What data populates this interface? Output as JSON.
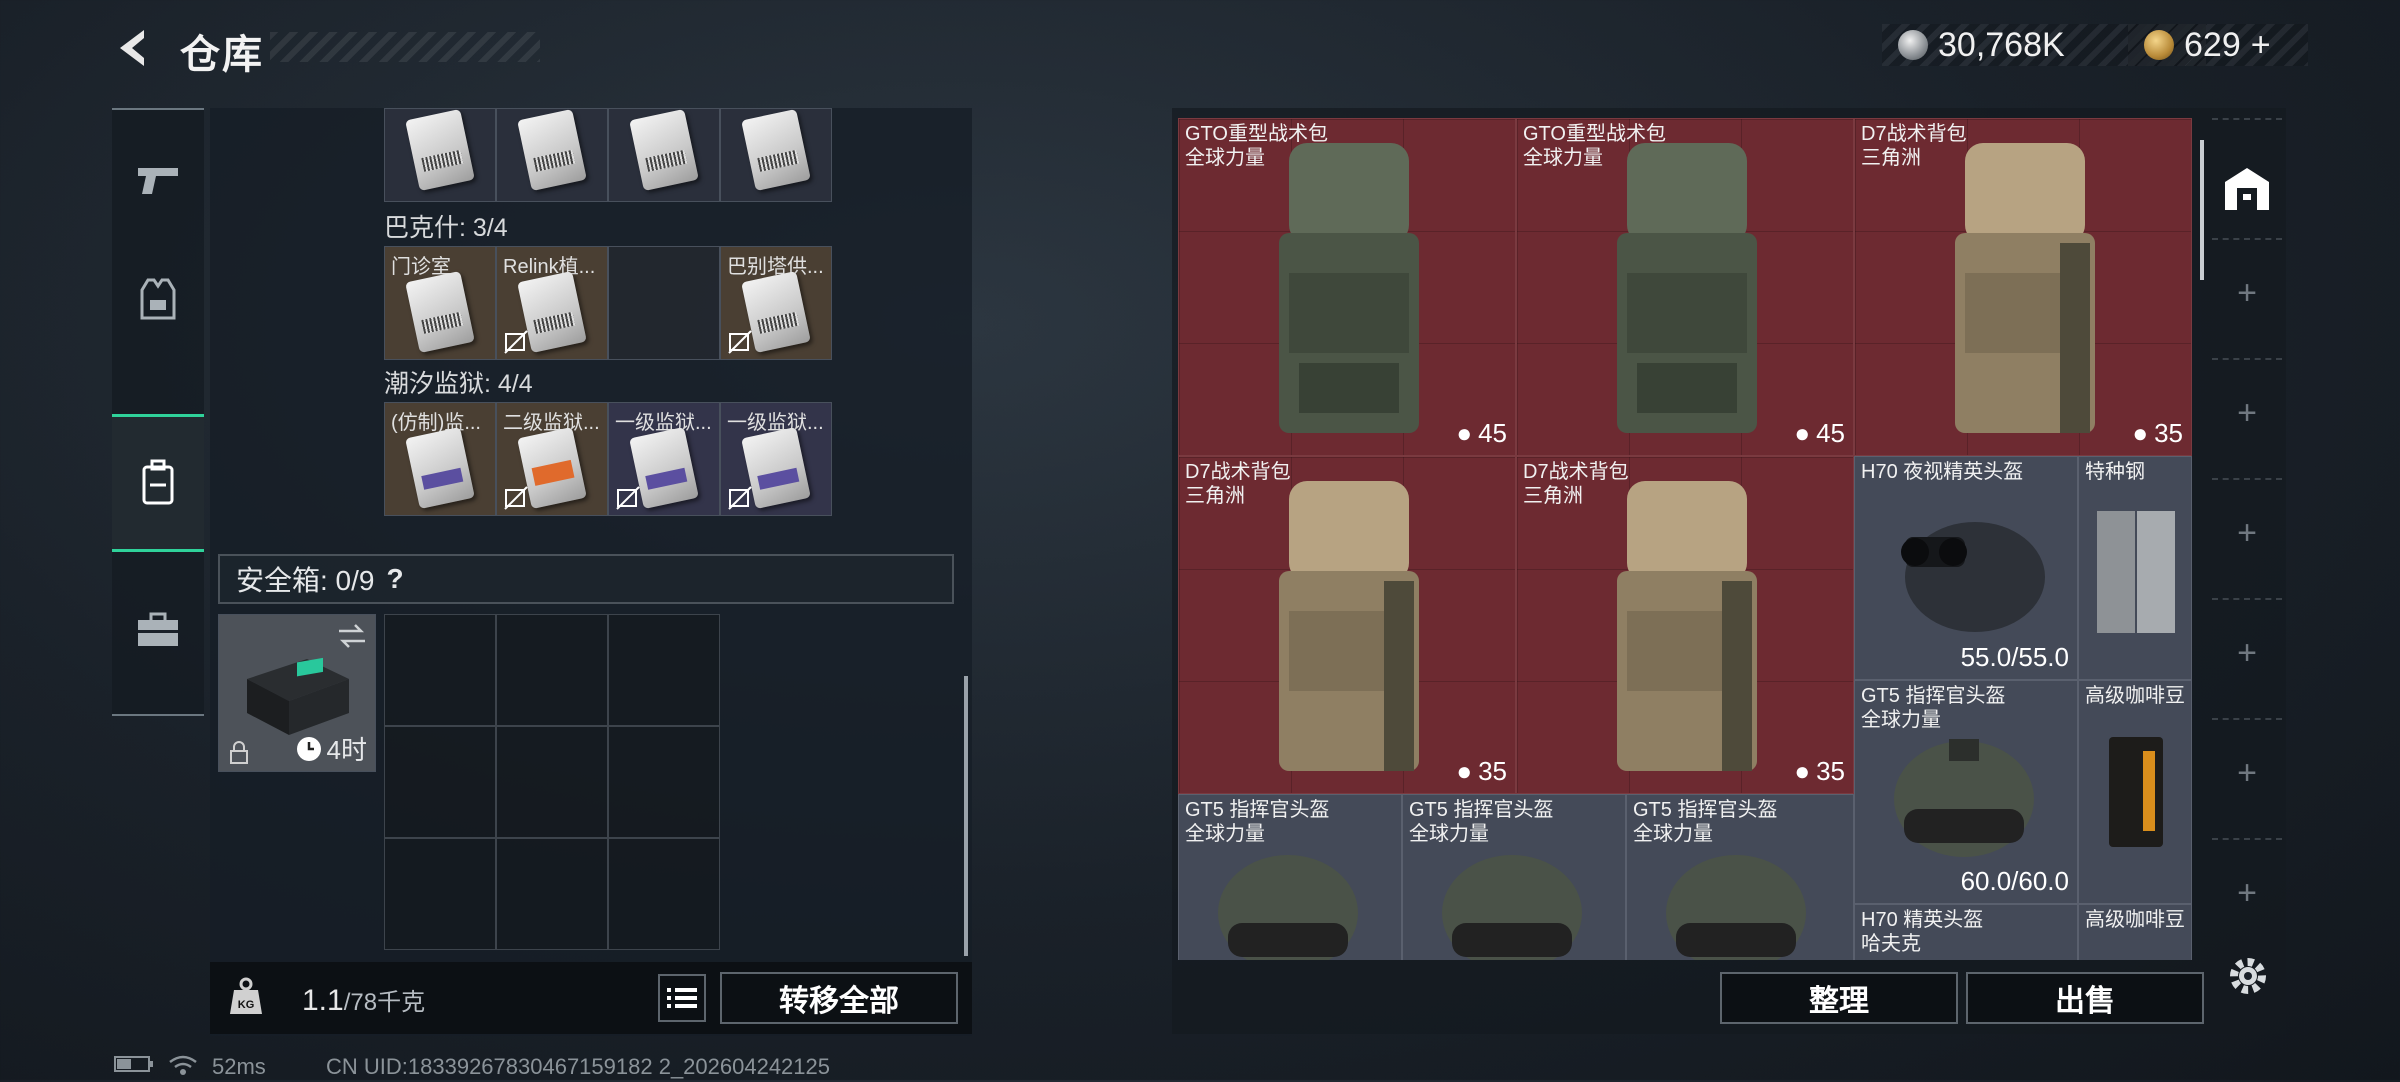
{
  "header": {
    "title": "仓库",
    "currency_silver": "30,768K",
    "currency_gold": "629",
    "currency_add": "+"
  },
  "nav": {
    "items": [
      "weapon-icon",
      "armor-icon",
      "backpack-icon",
      "toolbox-icon"
    ],
    "active": "backpack-icon"
  },
  "left": {
    "sections": [
      {
        "label": "巴克什: 3/4",
        "slots": [
          "门诊室",
          "Relink植...",
          "",
          "巴别塔供..."
        ]
      },
      {
        "label": "潮汐监狱: 4/4",
        "slots": [
          "(仿制)监...",
          "二级监狱...",
          "一级监狱...",
          "一级监狱..."
        ]
      }
    ],
    "safe_box": {
      "label": "安全箱: 0/9",
      "help": "?",
      "timer": "4时"
    },
    "weight_value": "1.1",
    "weight_total": "/78千克",
    "transfer_all": "转移全部"
  },
  "right": {
    "items": [
      {
        "name": "GTO重型战术包",
        "sub": "全球力量",
        "value": "45"
      },
      {
        "name": "GTO重型战术包",
        "sub": "全球力量",
        "value": "45"
      },
      {
        "name": "D7战术背包",
        "sub": "三角洲",
        "value": "35"
      },
      {
        "name": "D7战术背包",
        "sub": "三角洲",
        "value": "35"
      },
      {
        "name": "D7战术背包",
        "sub": "三角洲",
        "value": "35"
      },
      {
        "name": "H70 夜视精英头盔",
        "sub": "",
        "value": "55.0/55.0"
      },
      {
        "name": "特种钢",
        "sub": "",
        "value": ""
      },
      {
        "name": "GT5 指挥官头盔",
        "sub": "全球力量",
        "value": "60.0/60.0"
      },
      {
        "name": "高级咖啡豆",
        "sub": "",
        "value": ""
      },
      {
        "name": "GT5 指挥官头盔",
        "sub": "全球力量",
        "value": ""
      },
      {
        "name": "GT5 指挥官头盔",
        "sub": "全球力量",
        "value": ""
      },
      {
        "name": "GT5 指挥官头盔",
        "sub": "全球力量",
        "value": ""
      },
      {
        "name": "H70 精英头盔",
        "sub": "哈夫克",
        "value": ""
      },
      {
        "name": "高级咖啡豆",
        "sub": "",
        "value": ""
      }
    ],
    "sort_button": "整理",
    "sell_button": "出售"
  },
  "status": {
    "ping": "52ms",
    "uid": "CN UID:18339267830467159182 2_202604242125"
  },
  "colors": {
    "accent": "#2fd29a",
    "item_red": "#6d2a31"
  }
}
